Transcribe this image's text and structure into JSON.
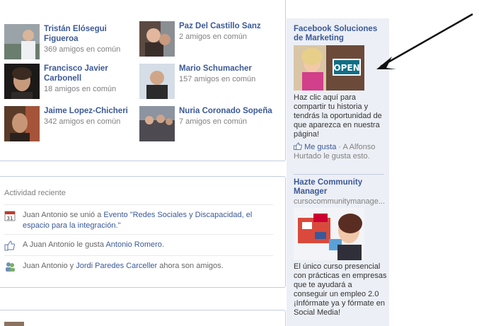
{
  "friends": [
    {
      "name": "Tristán Elósegui Figueroa",
      "mutual": "369 amigos en común"
    },
    {
      "name": "Paz Del Castillo Sanz",
      "mutual": "2 amigos en común"
    },
    {
      "name": "Francisco Javier Carbonell",
      "mutual": "18 amigos en común"
    },
    {
      "name": "Mario Schumacher",
      "mutual": "157 amigos en común"
    },
    {
      "name": "Jaime Lopez-Chicheri",
      "mutual": "342 amigos en común"
    },
    {
      "name": "Nuria Coronado Sopeña",
      "mutual": "7 amigos en común"
    }
  ],
  "activity": {
    "title": "Actividad reciente",
    "items": [
      {
        "icon": "calendar-icon",
        "text1": "Juan Antonio se unió a ",
        "link1": "Evento \"Redes Sociales y Discapacidad, el espacio para la integración.\"",
        "text2": ""
      },
      {
        "icon": "thumbs-up-icon",
        "text1": "A Juan Antonio le gusta ",
        "link1": "Antonio Romero",
        "text2": "."
      },
      {
        "icon": "friends-icon",
        "text1": "Juan Antonio y ",
        "link1": "Jordi Paredes Carceller",
        "text2": " ahora son amigos."
      }
    ]
  },
  "ads": [
    {
      "title": "Facebook Soluciones de Marketing",
      "domain": "",
      "body": "Haz clic aquí para compartir tu historia y tendrás la oportunidad de que aparezca en nuestra página!",
      "like_link": "Me gusta",
      "like_rest": " · A Alfonso Hurtado le gusta esto."
    },
    {
      "title": "Hazte Community Manager",
      "domain": "cursocommunitymanage...",
      "body": "El único curso presencial con prácticas en empresas que te ayudará a conseguir un empleo 2.0 ¡Infórmate ya y fórmate en Social Media!"
    }
  ],
  "colors": {
    "link": "#3b5998",
    "ad_bg": "#eceff5",
    "border": "#c4cde0"
  }
}
